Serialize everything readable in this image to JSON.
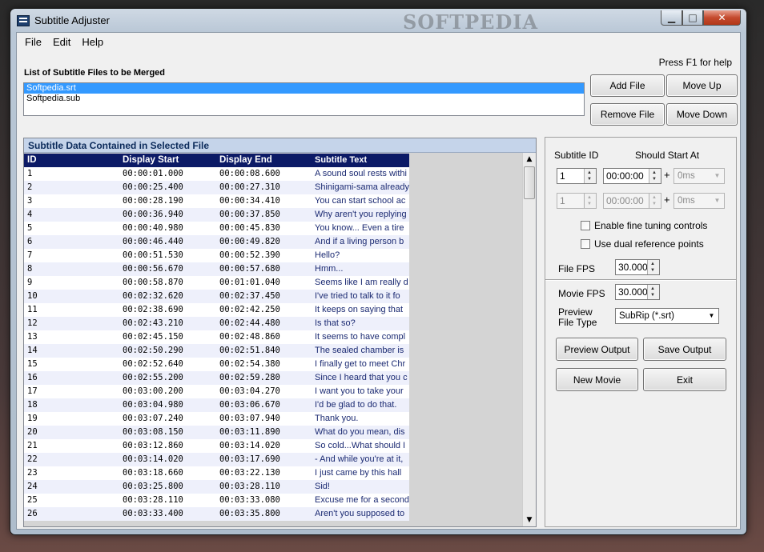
{
  "window": {
    "title": "Subtitle Adjuster",
    "watermark": "SOFTPEDIA",
    "min": "▁",
    "max": "□",
    "close": "✕"
  },
  "menu": [
    "File",
    "Edit",
    "Help"
  ],
  "help_hint": "Press F1 for help",
  "files": {
    "label": "List of Subtitle Files to be Merged",
    "items": [
      "Softpedia.srt",
      "Softpedia.sub"
    ],
    "selected_index": 0
  },
  "file_buttons": {
    "add": "Add File",
    "up": "Move Up",
    "remove": "Remove File",
    "down": "Move Down"
  },
  "grid": {
    "caption": "Subtitle Data Contained in Selected File",
    "columns": [
      "ID",
      "Display Start",
      "Display End",
      "Subtitle Text"
    ],
    "rows": [
      [
        "1",
        "00:00:01.000",
        "00:00:08.600",
        "A sound soul rests withi"
      ],
      [
        "2",
        "00:00:25.400",
        "00:00:27.310",
        "Shinigami-sama already"
      ],
      [
        "3",
        "00:00:28.190",
        "00:00:34.410",
        "You can start school ac"
      ],
      [
        "4",
        "00:00:36.940",
        "00:00:37.850",
        "Why aren't you replying"
      ],
      [
        "5",
        "00:00:40.980",
        "00:00:45.830",
        "You know... Even a tire"
      ],
      [
        "6",
        "00:00:46.440",
        "00:00:49.820",
        "And if a living person b"
      ],
      [
        "7",
        "00:00:51.530",
        "00:00:52.390",
        "Hello?"
      ],
      [
        "8",
        "00:00:56.670",
        "00:00:57.680",
        "Hmm..."
      ],
      [
        "9",
        "00:00:58.870",
        "00:01:01.040",
        "Seems like I am really d"
      ],
      [
        "10",
        "00:02:32.620",
        "00:02:37.450",
        "I've tried to talk to it fo"
      ],
      [
        "11",
        "00:02:38.690",
        "00:02:42.250",
        "It keeps on saying that"
      ],
      [
        "12",
        "00:02:43.210",
        "00:02:44.480",
        "Is that so?"
      ],
      [
        "13",
        "00:02:45.150",
        "00:02:48.860",
        "It seems to have compl"
      ],
      [
        "14",
        "00:02:50.290",
        "00:02:51.840",
        "The sealed chamber is"
      ],
      [
        "15",
        "00:02:52.640",
        "00:02:54.380",
        "I finally get to meet Chr"
      ],
      [
        "16",
        "00:02:55.200",
        "00:02:59.280",
        "Since I heard that you c"
      ],
      [
        "17",
        "00:03:00.200",
        "00:03:04.270",
        "I want you to take your"
      ],
      [
        "18",
        "00:03:04.980",
        "00:03:06.670",
        "I'd be glad to do that."
      ],
      [
        "19",
        "00:03:07.240",
        "00:03:07.940",
        "Thank you."
      ],
      [
        "20",
        "00:03:08.150",
        "00:03:11.890",
        "What do you mean, dis"
      ],
      [
        "21",
        "00:03:12.860",
        "00:03:14.020",
        "So cold...What should I"
      ],
      [
        "22",
        "00:03:14.020",
        "00:03:17.690",
        "- And while you're at it,"
      ],
      [
        "23",
        "00:03:18.660",
        "00:03:22.130",
        "I just came by this hall"
      ],
      [
        "24",
        "00:03:25.800",
        "00:03:28.110",
        "Sid!"
      ],
      [
        "25",
        "00:03:28.110",
        "00:03:33.080",
        "Excuse me for a second"
      ],
      [
        "26",
        "00:03:33.400",
        "00:03:35.800",
        "Aren't you supposed to"
      ]
    ]
  },
  "adjust": {
    "subtitle_id_label": "Subtitle ID",
    "should_start_label": "Should Start At",
    "row1": {
      "id": "1",
      "time": "00:00:00",
      "plus": "+",
      "offset": "0ms"
    },
    "row2": {
      "id": "1",
      "time": "00:00:00",
      "plus": "+",
      "offset": "0ms"
    },
    "fine_tuning": "Enable fine tuning controls",
    "dual_ref": "Use dual reference points",
    "file_fps_label": "File FPS",
    "file_fps": "30.000",
    "movie_fps_label": "Movie FPS",
    "movie_fps": "30.000",
    "preview_label_1": "Preview",
    "preview_label_2": "File Type",
    "file_type": "SubRip (*.srt)",
    "buttons": {
      "preview": "Preview Output",
      "save": "Save Output",
      "new": "New Movie",
      "exit": "Exit"
    }
  },
  "scroll": {
    "up": "▲",
    "down": "▼"
  }
}
